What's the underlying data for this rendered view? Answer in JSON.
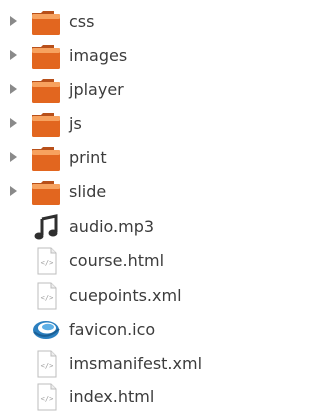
{
  "file_tree": {
    "items": [
      {
        "label": "css",
        "type": "folder",
        "icon": "folder-icon"
      },
      {
        "label": "images",
        "type": "folder",
        "icon": "folder-icon"
      },
      {
        "label": "jplayer",
        "type": "folder",
        "icon": "folder-icon"
      },
      {
        "label": "js",
        "type": "folder",
        "icon": "folder-icon"
      },
      {
        "label": "print",
        "type": "folder",
        "icon": "folder-icon"
      },
      {
        "label": "slide",
        "type": "folder",
        "icon": "folder-icon"
      },
      {
        "label": "audio.mp3",
        "type": "file",
        "icon": "audio-file-icon"
      },
      {
        "label": "course.html",
        "type": "file",
        "icon": "html-file-icon"
      },
      {
        "label": "cuepoints.xml",
        "type": "file",
        "icon": "xml-file-icon"
      },
      {
        "label": "favicon.ico",
        "type": "file",
        "icon": "favicon-image-icon"
      },
      {
        "label": "imsmanifest.xml",
        "type": "file",
        "icon": "xml-file-icon"
      },
      {
        "label": "index.html",
        "type": "file",
        "icon": "html-file-icon"
      }
    ]
  },
  "colors": {
    "folder_orange": "#e2661f",
    "folder_light": "#f7a25f",
    "text": "#3c3c3c",
    "expander": "#8a8a8a"
  }
}
